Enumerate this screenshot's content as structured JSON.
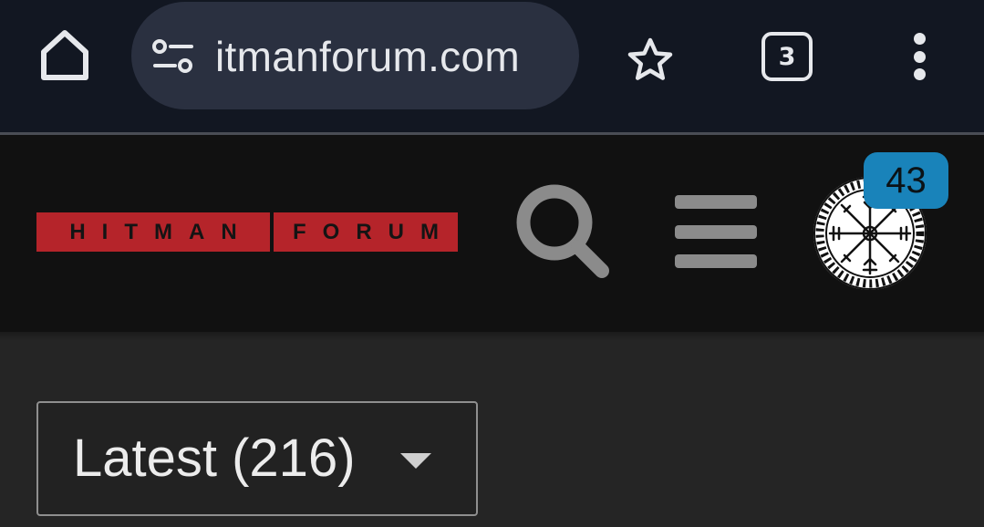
{
  "browser": {
    "url": "itmanforum.com",
    "tab_count": "3",
    "icons": [
      "home-icon",
      "site-settings-icon",
      "star-icon",
      "tab-switcher-icon",
      "more-vert-icon"
    ],
    "colors": {
      "bar": "#121722",
      "url_pill": "#2a3040",
      "foreground": "#e6e8ec"
    }
  },
  "forum_header": {
    "logo_left": "HITMAN",
    "logo_right": "FORUM",
    "notification_count": "43",
    "icons": [
      "search-icon",
      "hamburger-menu-icon",
      "vegvisir-avatar"
    ],
    "colors": {
      "logo_red": "#b5242a",
      "badge": "#1983ba",
      "header_bg": "#111111"
    }
  },
  "content": {
    "filter_label": "Latest (216)",
    "filter_icon": "caret-down-icon"
  }
}
